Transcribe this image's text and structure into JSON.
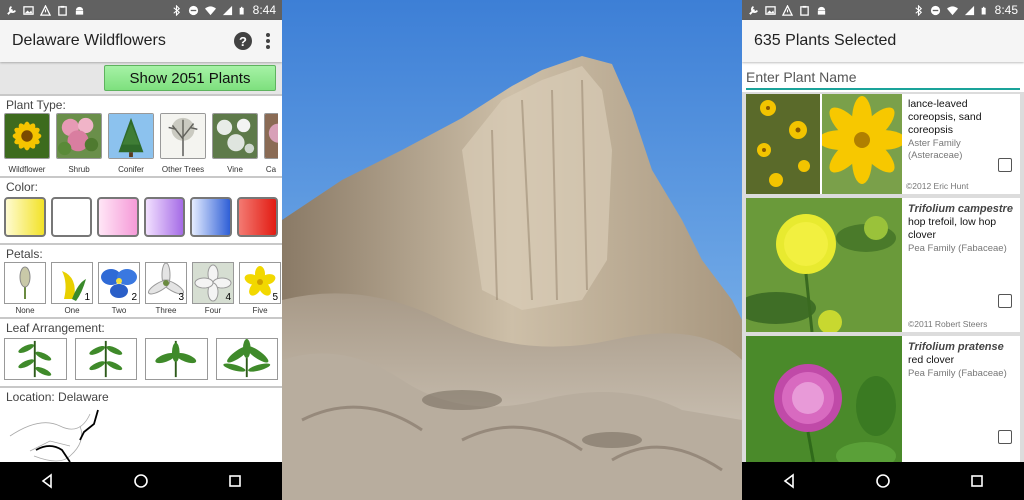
{
  "left": {
    "status": {
      "time": "8:44"
    },
    "appbar": {
      "title": "Delaware Wildflowers",
      "help": "?"
    },
    "show_button": "Show 2051 Plants",
    "plant_type": {
      "label": "Plant Type:",
      "items": [
        {
          "caption": "Wildflower"
        },
        {
          "caption": "Shrub"
        },
        {
          "caption": "Conifer"
        },
        {
          "caption": "Other Trees"
        },
        {
          "caption": "Vine"
        },
        {
          "caption": "Ca"
        }
      ]
    },
    "color": {
      "label": "Color:",
      "swatches": [
        "yellow",
        "white",
        "pink",
        "purple",
        "blue",
        "red"
      ]
    },
    "petals": {
      "label": "Petals:",
      "items": [
        {
          "caption": "None",
          "num": ""
        },
        {
          "caption": "One",
          "num": "1"
        },
        {
          "caption": "Two",
          "num": "2"
        },
        {
          "caption": "Three",
          "num": "3"
        },
        {
          "caption": "Four",
          "num": "4"
        },
        {
          "caption": "Five",
          "num": "5"
        }
      ]
    },
    "leaf": {
      "label": "Leaf Arrangement:"
    },
    "location": {
      "label": "Location: Delaware"
    }
  },
  "right": {
    "status": {
      "time": "8:45"
    },
    "appbar": {
      "title": "635 Plants Selected"
    },
    "search": {
      "placeholder": "Enter Plant Name"
    },
    "plants": [
      {
        "scientific": "",
        "common": "lance-leaved coreopsis, sand coreopsis",
        "family": "Aster Family (Asteraceae)",
        "credit": "©2012 Eric Hunt"
      },
      {
        "scientific": "Trifolium campestre",
        "common": "hop trefoil, low hop clover",
        "family": "Pea Family (Fabaceae)",
        "credit": "©2011 Robert Steers"
      },
      {
        "scientific": "Trifolium pratense",
        "common": "red clover",
        "family": "Pea Family (Fabaceae)",
        "credit": ""
      }
    ]
  }
}
